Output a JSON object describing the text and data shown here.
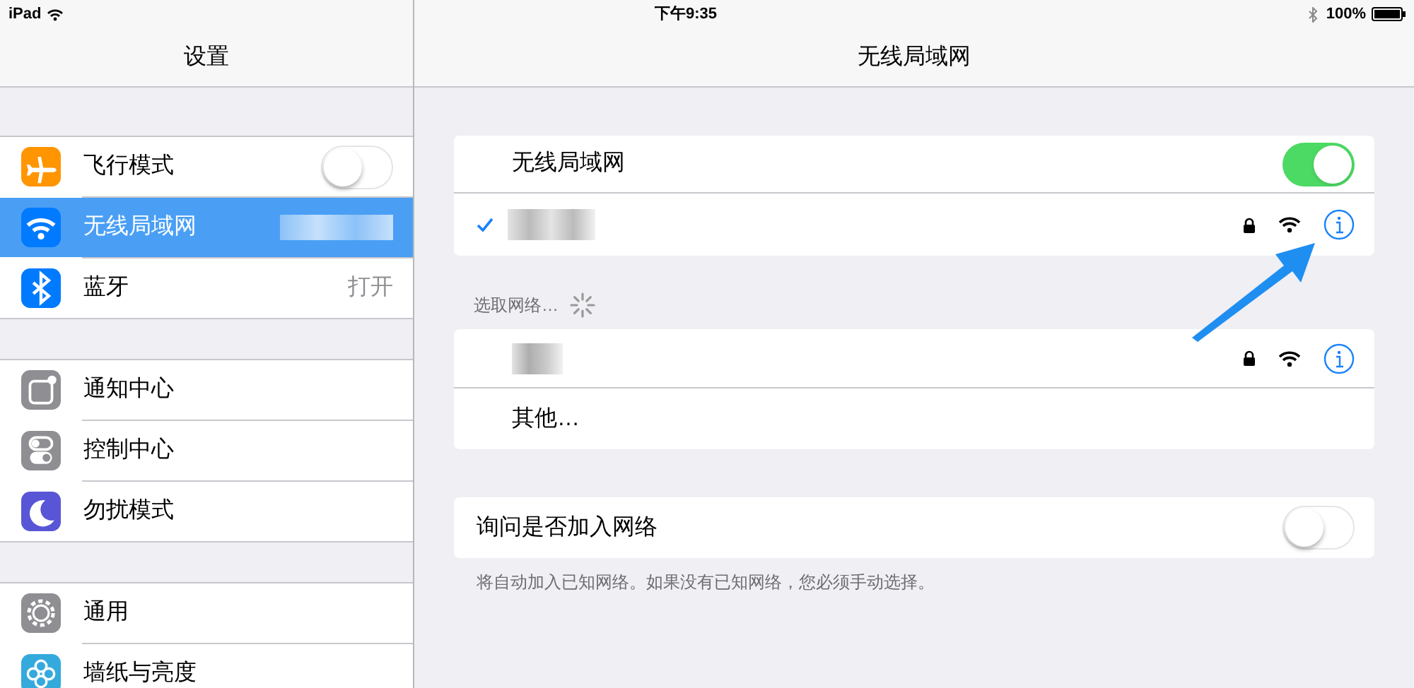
{
  "status_bar": {
    "device": "iPad",
    "time": "下午9:35",
    "battery": "100%"
  },
  "sidebar": {
    "title": "设置",
    "groups": [
      [
        {
          "label": "飞行模式",
          "kind": "toggle",
          "on": false,
          "selected": false
        },
        {
          "label": "无线局域网",
          "kind": "redacted",
          "selected": true
        },
        {
          "label": "蓝牙",
          "kind": "value",
          "value": "打开",
          "selected": false
        }
      ],
      [
        {
          "label": "通知中心",
          "kind": "link",
          "selected": false
        },
        {
          "label": "控制中心",
          "kind": "link",
          "selected": false
        },
        {
          "label": "勿扰模式",
          "kind": "link",
          "selected": false
        }
      ],
      [
        {
          "label": "通用",
          "kind": "link",
          "selected": false
        },
        {
          "label": "墙纸与亮度",
          "kind": "link",
          "selected": false
        }
      ]
    ]
  },
  "detail": {
    "title": "无线局域网",
    "wifi_toggle": {
      "label": "无线局域网",
      "on": true
    },
    "connected": {
      "checked": true,
      "locked": true
    },
    "choose_header": "选取网络…",
    "networks": [
      {
        "locked": true
      }
    ],
    "other": "其他…",
    "ask_toggle": {
      "label": "询问是否加入网络",
      "on": false
    },
    "footer": "将自动加入已知网络。如果没有已知网络，您必须手动选择。"
  }
}
